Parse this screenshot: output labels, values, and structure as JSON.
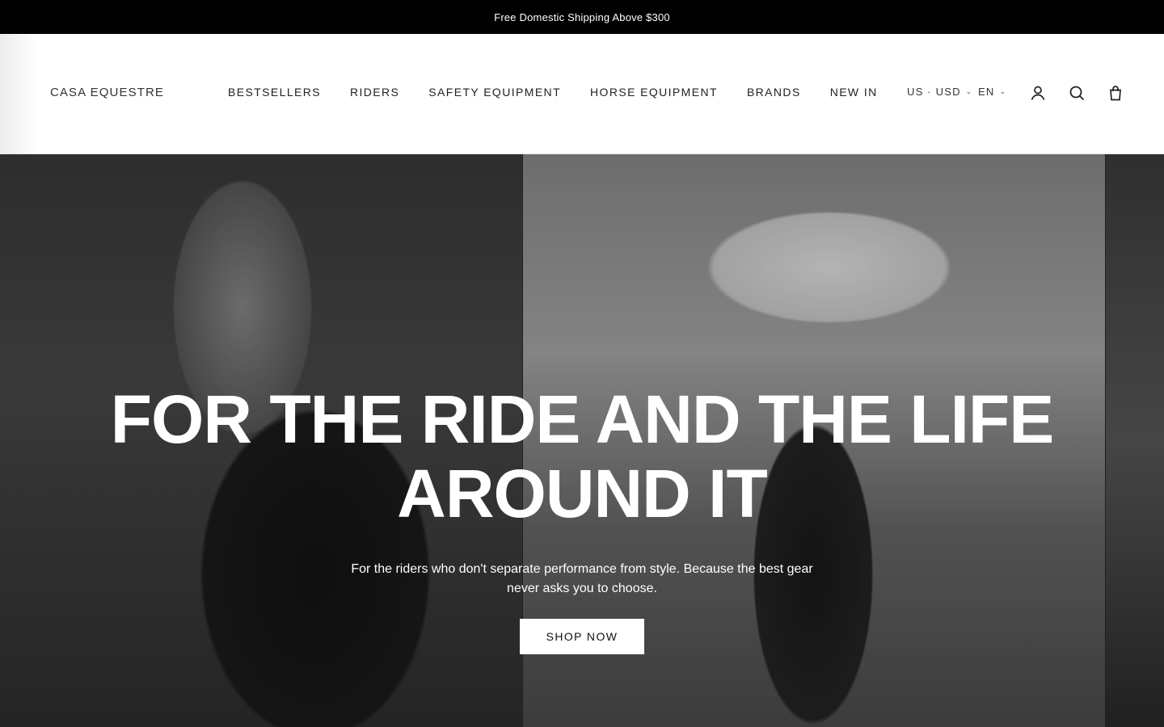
{
  "announcement": {
    "text": "Free Domestic Shipping Above $300"
  },
  "header": {
    "logo": "CASA EQUESTRE",
    "nav": [
      {
        "label": "BESTSELLERS"
      },
      {
        "label": "RIDERS"
      },
      {
        "label": "SAFETY EQUIPMENT"
      },
      {
        "label": "HORSE EQUIPMENT"
      },
      {
        "label": "BRANDS"
      },
      {
        "label": "NEW IN"
      }
    ],
    "currency": "US · USD",
    "language": "EN",
    "icons": [
      "account-icon",
      "search-icon",
      "cart-icon"
    ]
  },
  "hero": {
    "title_line1": "FOR THE RIDE AND THE LIFE",
    "title_line2": "AROUND IT",
    "subtitle_line1": "For the riders who don't separate performance from style. Because the best gear",
    "subtitle_line2": "never asks you to choose.",
    "cta": "SHOP NOW"
  },
  "colors": {
    "announcement_bg": "#000000",
    "header_bg": "#ffffff",
    "cta_bg": "#ffffff",
    "hero_text": "#ffffff"
  }
}
